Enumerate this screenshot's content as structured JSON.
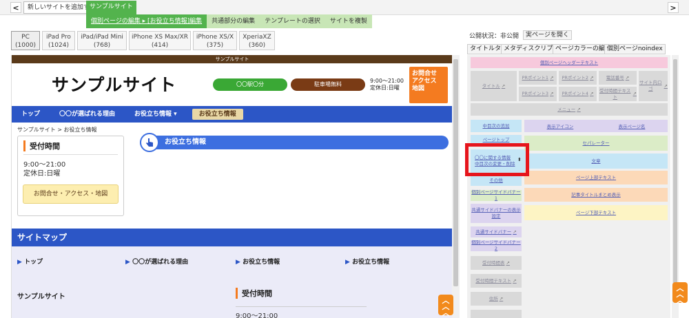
{
  "topbar": {
    "prev_arrow": "<",
    "next_arrow": ">",
    "add_site_label": "新しいサイトを追加する",
    "site_name": "サンプルサイト"
  },
  "subnav": {
    "items": [
      "個別ページの編集 ▸ [お役立ち情報]編集",
      "共通部分の編集",
      "テンプレートの選択",
      "サイトを複製"
    ]
  },
  "devices": [
    {
      "name": "PC",
      "width": "(1000)"
    },
    {
      "name": "iPad Pro",
      "width": "(1024)"
    },
    {
      "name": "iPad/iPad Mini",
      "width": "(768)"
    },
    {
      "name": "iPhone XS Max/XR",
      "width": "(414)"
    },
    {
      "name": "iPhone XS/X",
      "width": "(375)"
    },
    {
      "name": "XperiaXZ",
      "width": "(360)"
    }
  ],
  "preview": {
    "top_strip": "サンプルサイト",
    "site_title": "サンプルサイト",
    "station_pill": "〇〇駅〇分",
    "parking_pill": "駐車場無料",
    "hours_line1": "9:00～21:00",
    "hours_line2": "定休日:日曜",
    "contact_btn": [
      "お問合せ",
      "アクセス",
      "地図"
    ],
    "gnav": [
      "トップ",
      "〇〇が選ばれる理由",
      "お役立ち情報 ▾",
      "お役立ち情報"
    ],
    "breadcrumb": "サンプルサイト > お役立ち情報",
    "sidebox": {
      "title": "受付時間",
      "hours": "9:00～21:00",
      "closed": "定休日:日曜",
      "button": "お問合せ・アクセス・地図"
    },
    "page_heading": "お役立ち情報",
    "sitemap": {
      "heading": "サイトマップ",
      "links": [
        "トップ",
        "〇〇が選ばれる理由",
        "お役立ち情報",
        "お役立ち情報"
      ],
      "site_name": "サンプルサイト",
      "reception_title": "受付時間",
      "reception_hours": "9:00～21:00"
    }
  },
  "right": {
    "status": "公開状況：非公開",
    "open_page": "実ページを開く",
    "tabs": [
      "タイトルタグ",
      "メタディスクリプション",
      "ページカラーの編集",
      "個別ページnoindex"
    ],
    "header_text": "個別ページヘッダーテキスト",
    "title_block": "タイトル",
    "pr": [
      "PRポイント1",
      "PRポイント2",
      "PRポイント3",
      "PRポイント4"
    ],
    "tel": "電話番号",
    "reception_text": "受付時間テキスト",
    "site_logo": "サイト内ロゴ",
    "menu": "メニュー",
    "left_col": [
      "中目次の追加",
      "ページトップ",
      "〇〇に関する情報",
      "中目次の変更・削除",
      "その他",
      "個別ページサイドバナー1",
      "共通サイドバナーの表示設定",
      "共通サイドバナー",
      "個別ページサイドバナー2",
      "受付時間表",
      "受付時間テキスト",
      "住所"
    ],
    "right_col": {
      "display_icon": "表示アイコン",
      "display_page": "表示ページ名",
      "separator": "セパレーター",
      "body": "文章",
      "page_top_text": "ページ上部テキスト",
      "article_title": "記事タイトルまとめ表示",
      "page_bottom_text": "ページ下部テキスト"
    }
  }
}
